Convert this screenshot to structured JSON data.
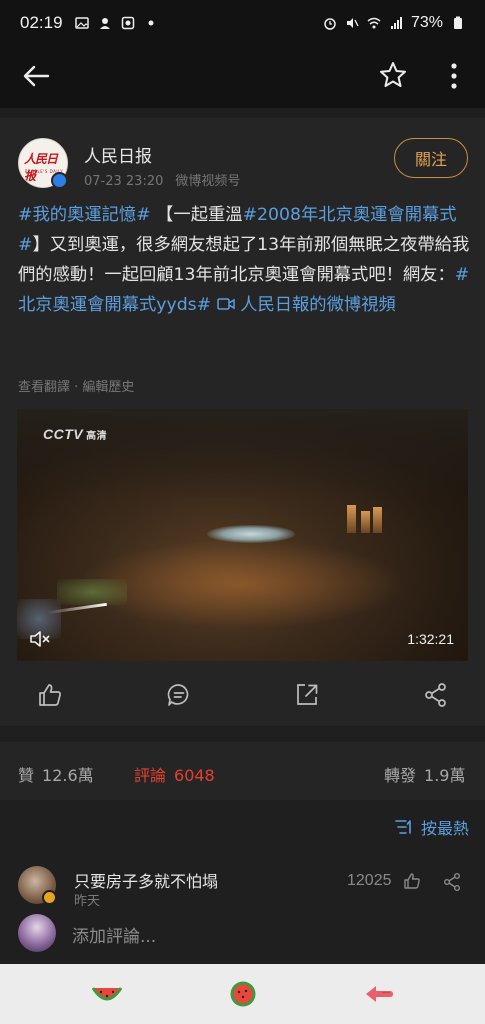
{
  "status_bar": {
    "time": "02:19",
    "battery": "73%"
  },
  "post": {
    "author": "人民日报",
    "date": "07-23 23:20",
    "source": "微博视频号",
    "follow_label": "關注",
    "avatar_logo": "人民日报",
    "avatar_sub": "PEOPLE'S DAILY",
    "text": {
      "tag1": "#我的奧運記憶#",
      "p1": " 【一起重溫",
      "tag2": "#2008年北京奧運會開幕式#",
      "p2": "】又到奧運，很多網友想起了13年前那個無眠之夜帶給我們的感動！一起回顧13年前北京奧運會開幕式吧！網友：",
      "tag3": "#北京奧運會開幕式yyds#",
      "video_link": " 人民日報的微博視頻"
    },
    "see_translation": "查看翻譯",
    "edit_history": "編輯歷史",
    "video": {
      "logo": "CCTV",
      "logo_sub": "高清",
      "duration": "1:32:21"
    }
  },
  "stats": {
    "likes_label": "贊",
    "likes": "12.6萬",
    "comments_label": "評論",
    "comments": "6048",
    "reposts_label": "轉發",
    "reposts": "1.9萬"
  },
  "sort_label": "按最熱",
  "comment": {
    "name": "只要房子多就不怕塌",
    "time": "昨天",
    "likes": "12025"
  },
  "add_comment_placeholder": "添加評論..."
}
